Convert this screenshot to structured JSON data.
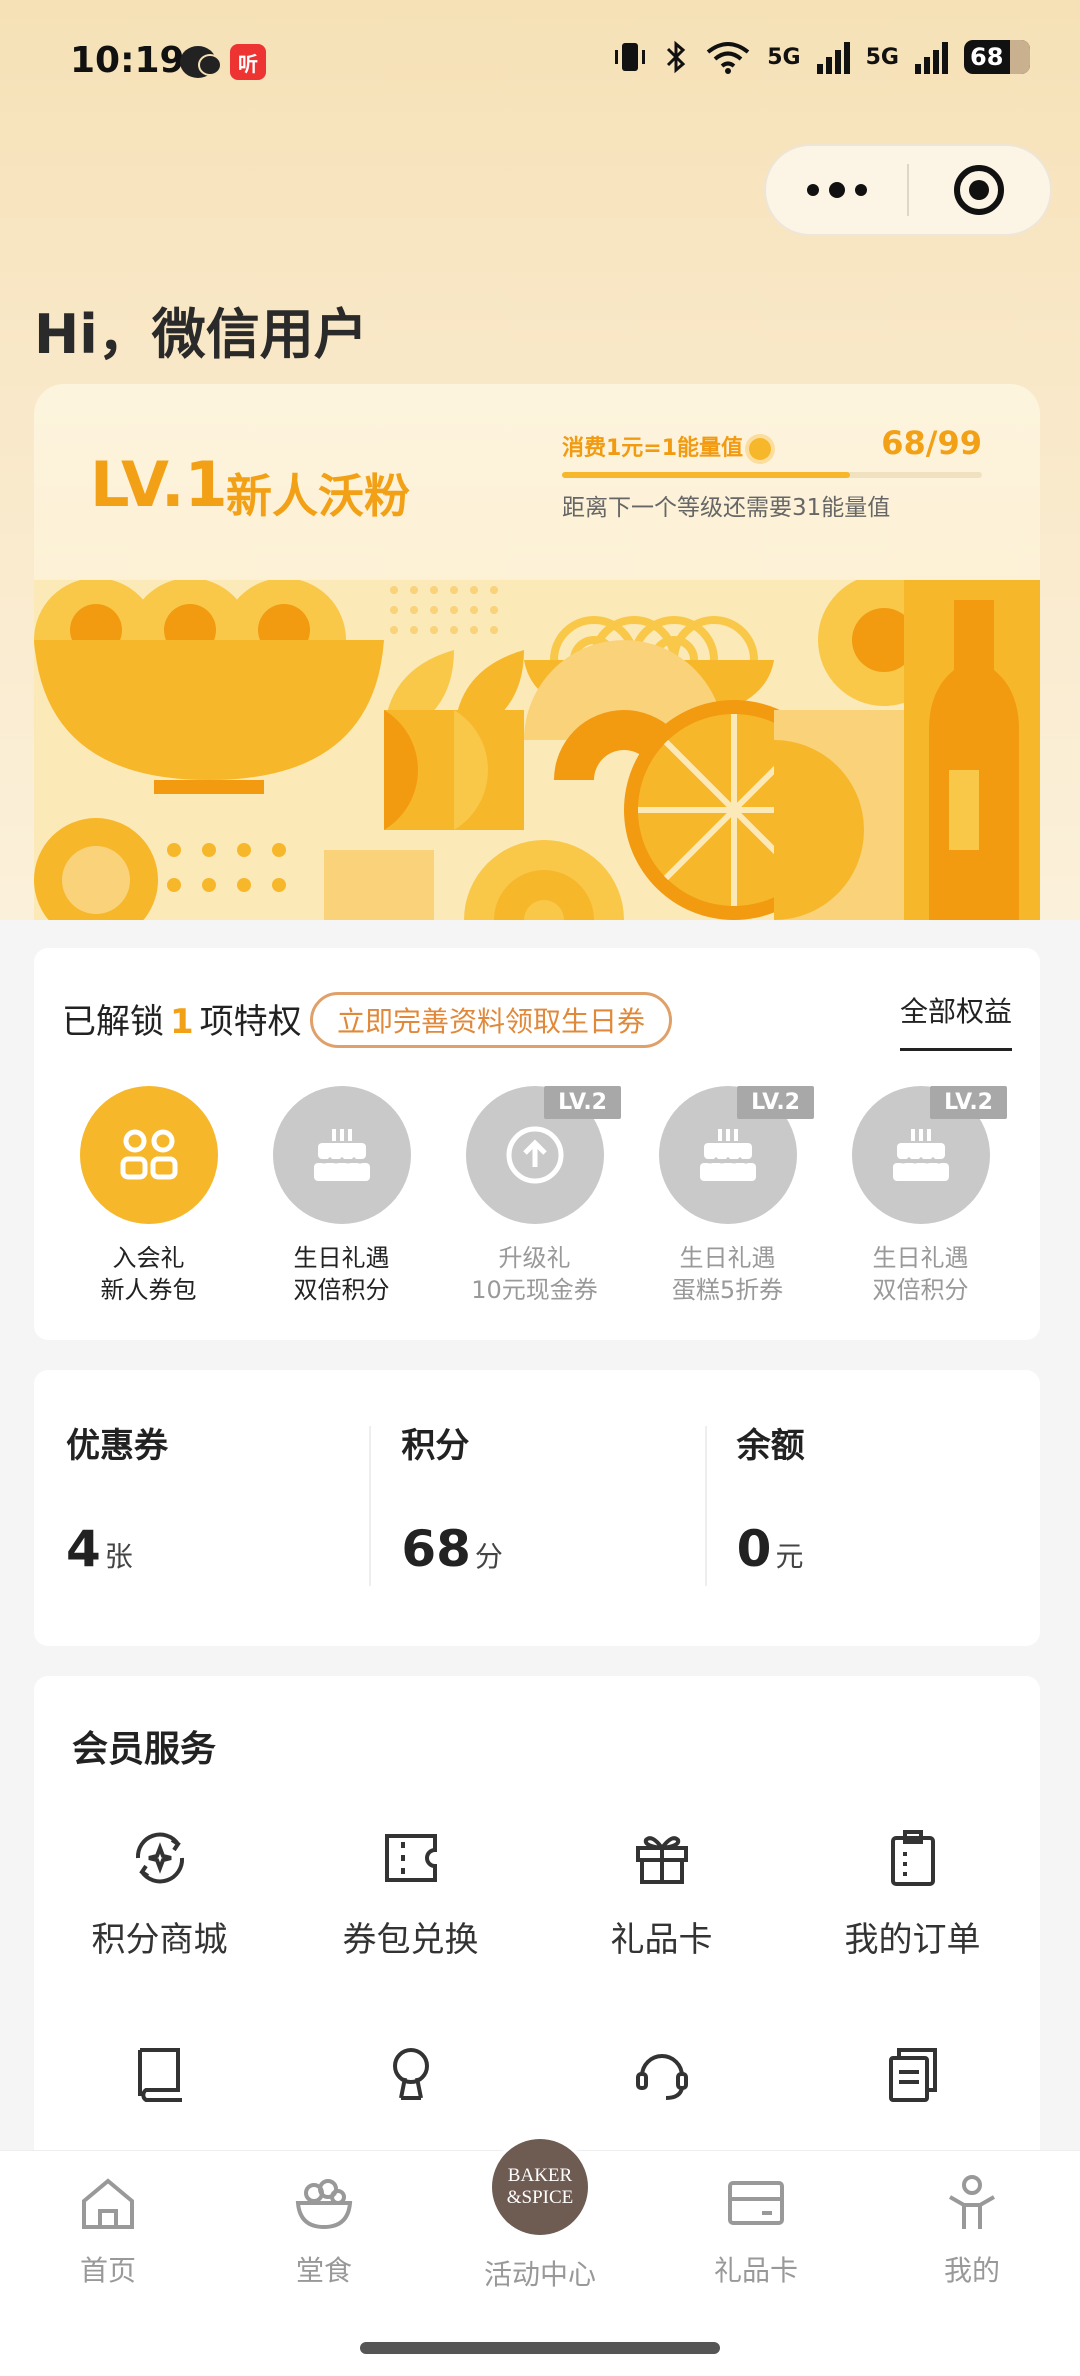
{
  "status_bar": {
    "time": "10:19",
    "app_badge": "听",
    "network_1": "5G",
    "network_2": "5G",
    "battery": "68"
  },
  "greeting": "Hi，微信用户",
  "member_card": {
    "level": "LV.1",
    "level_name": "新人沃粉",
    "energy_rule": "消费1元=1能量值",
    "progress_text": "68/99",
    "progress_value": 68,
    "progress_max": 99,
    "progress_tip": "距离下一个等级还需要31能量值"
  },
  "privileges": {
    "unlocked_prefix": "已解锁",
    "unlocked_count": "1",
    "unlocked_suffix": "项特权",
    "cta": "立即完善资料领取生日券",
    "all_link": "全部权益",
    "items": [
      {
        "line1": "入会礼",
        "line2": "新人券包",
        "badge": "",
        "icon": "people-icon",
        "state": "active"
      },
      {
        "line1": "生日礼遇",
        "line2": "双倍积分",
        "badge": "",
        "icon": "cake-icon",
        "state": "mid"
      },
      {
        "line1": "升级礼",
        "line2": "10元现金券",
        "badge": "LV.2",
        "icon": "upgrade-icon",
        "state": "locked"
      },
      {
        "line1": "生日礼遇",
        "line2": "蛋糕5折券",
        "badge": "LV.2",
        "icon": "cake-icon",
        "state": "locked"
      },
      {
        "line1": "生日礼遇",
        "line2": "双倍积分",
        "badge": "LV.2",
        "icon": "cake-icon",
        "state": "locked"
      }
    ]
  },
  "assets": [
    {
      "title": "优惠券",
      "value": "4",
      "unit": "张"
    },
    {
      "title": "积分",
      "value": "68",
      "unit": "分"
    },
    {
      "title": "余额",
      "value": "0",
      "unit": "元"
    }
  ],
  "services": {
    "title": "会员服务",
    "items": [
      {
        "label": "积分商城",
        "icon": "points-mall-icon"
      },
      {
        "label": "券包兑换",
        "icon": "ticket-icon"
      },
      {
        "label": "礼品卡",
        "icon": "gift-icon"
      },
      {
        "label": "我的订单",
        "icon": "clipboard-icon"
      },
      {
        "label": "",
        "icon": "book-icon"
      },
      {
        "label": "",
        "icon": "profile-icon"
      },
      {
        "label": "",
        "icon": "headset-icon"
      },
      {
        "label": "",
        "icon": "documents-icon"
      }
    ]
  },
  "tabbar": {
    "items": [
      {
        "label": "首页",
        "icon": "home-icon"
      },
      {
        "label": "堂食",
        "icon": "bowl-icon"
      },
      {
        "label": "活动中心",
        "icon": "brand-logo"
      },
      {
        "label": "礼品卡",
        "icon": "card-icon"
      },
      {
        "label": "我的",
        "icon": "person-icon"
      }
    ],
    "logo_line1": "BAKER",
    "logo_line2": "&SPICE"
  },
  "colors": {
    "accent": "#f7b72a",
    "accent_text": "#f2a117",
    "cta_border": "#e0a06a",
    "locked_grey": "#c9c9c9",
    "logo_brown": "#6e5b52"
  }
}
